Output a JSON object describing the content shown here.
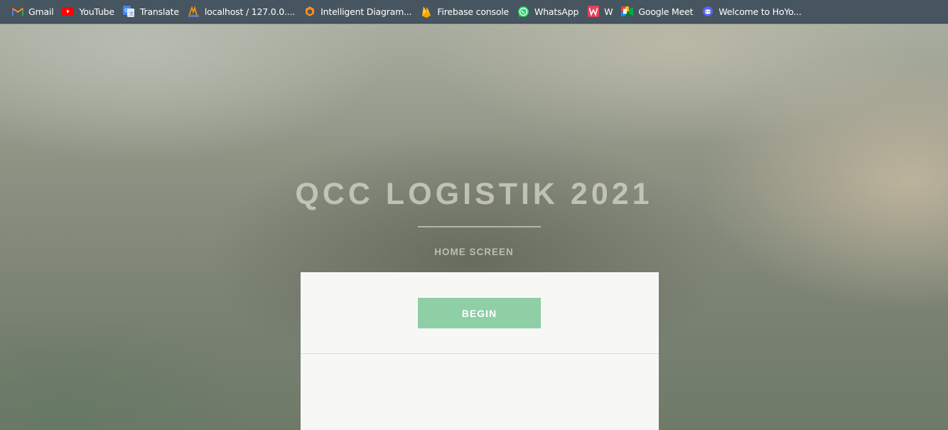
{
  "bookmarks": [
    {
      "label": "Gmail",
      "icon": "gmail-icon"
    },
    {
      "label": "YouTube",
      "icon": "youtube-icon"
    },
    {
      "label": "Translate",
      "icon": "translate-icon"
    },
    {
      "label": "localhost / 127.0.0....",
      "icon": "phpmyadmin-icon"
    },
    {
      "label": "Intelligent Diagram...",
      "icon": "diagram-icon"
    },
    {
      "label": "Firebase console",
      "icon": "firebase-icon"
    },
    {
      "label": "WhatsApp",
      "icon": "whatsapp-icon"
    },
    {
      "label": "W",
      "icon": "w-logo-icon"
    },
    {
      "label": "Google Meet",
      "icon": "google-meet-icon"
    },
    {
      "label": "Welcome to HoYo...",
      "icon": "discord-icon"
    }
  ],
  "main": {
    "title": "QCC LOGISTIK 2021",
    "subtitle": "HOME SCREEN",
    "begin_label": "BEGIN"
  },
  "colors": {
    "toolbar": "#465560",
    "button": "#8ecfa6",
    "card": "#f7f7f6"
  }
}
